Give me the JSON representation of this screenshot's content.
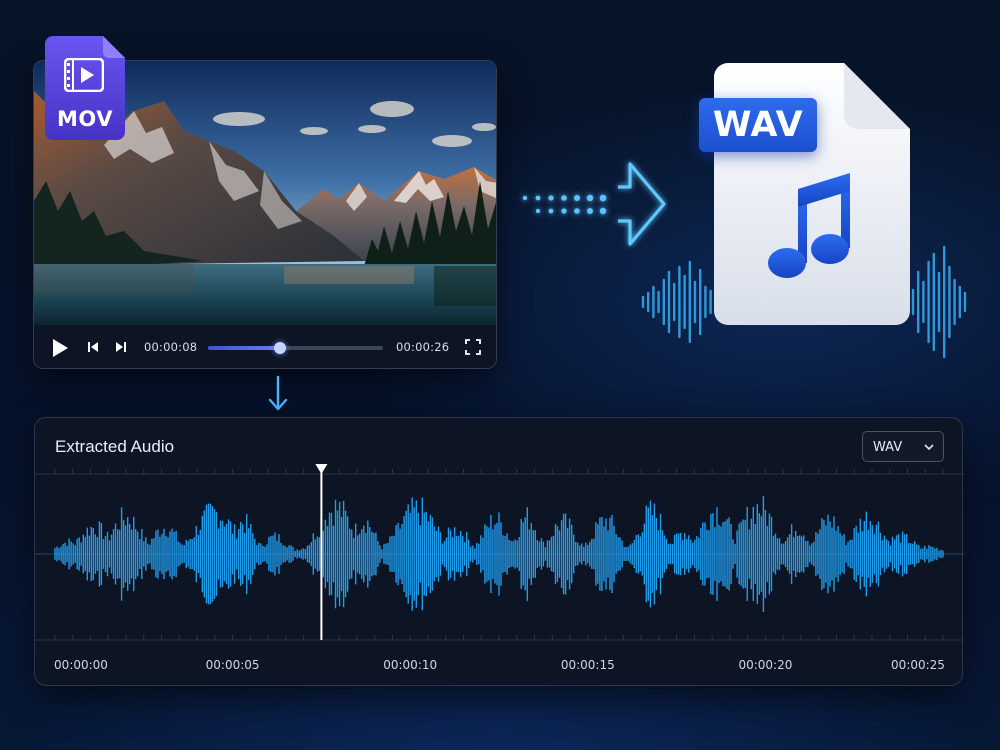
{
  "source_file": {
    "format_label": "MOV",
    "icon": "film-clip-icon"
  },
  "player": {
    "current_time": "00:00:08",
    "duration": "00:00:26",
    "progress": 0.41,
    "icons": {
      "play": "play-icon",
      "previous": "skip-back-icon",
      "next": "skip-forward-icon",
      "fullscreen": "fullscreen-icon"
    }
  },
  "output_file": {
    "format_label": "WAV",
    "icon": "music-note-icon"
  },
  "audio_panel": {
    "title": "Extracted Audio",
    "format_select": {
      "value": "WAV",
      "icon": "chevron-down-icon"
    },
    "playhead_time_seconds": 7.5,
    "timeline": {
      "max_seconds": 25,
      "labels": [
        "00:00:00",
        "00:00:05",
        "00:00:10",
        "00:00:15",
        "00:00:20",
        "00:00:25"
      ]
    },
    "colors": {
      "waveform": "#22a8ff",
      "playhead": "#ffffff"
    }
  },
  "colors": {
    "accent": "#2e6bea",
    "glow": "#38b6ff"
  }
}
